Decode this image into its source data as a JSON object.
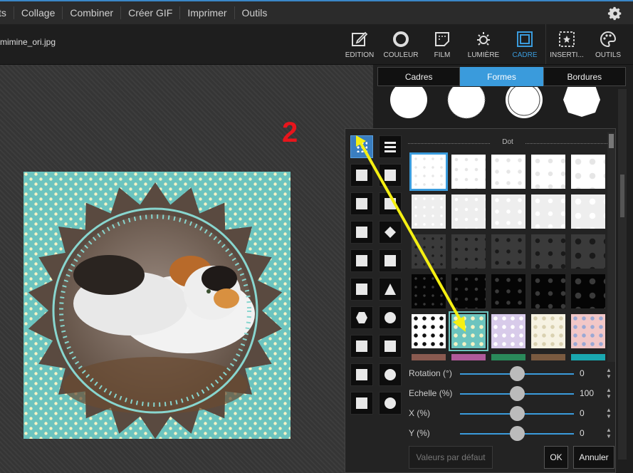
{
  "menu": {
    "items": [
      "ts",
      "Collage",
      "Combiner",
      "Créer GIF",
      "Imprimer",
      "Outils"
    ]
  },
  "file": {
    "name": "mimine_ori.jpg"
  },
  "toolbar": {
    "tools": [
      {
        "label": "EDITION",
        "icon": "edit-icon"
      },
      {
        "label": "COULEUR",
        "icon": "color-icon"
      },
      {
        "label": "FILM",
        "icon": "film-icon"
      },
      {
        "label": "LUMIÈRE",
        "icon": "light-icon"
      },
      {
        "label": "CADRE",
        "icon": "frame-icon",
        "active": true
      },
      {
        "label": "INSERTI...",
        "icon": "insert-icon"
      },
      {
        "label": "OUTILS",
        "icon": "tools-palette-icon"
      }
    ]
  },
  "tabs": {
    "cadres": "Cadres",
    "formes": "Formes",
    "bordures": "Bordures",
    "active": "Formes"
  },
  "pattern_group": {
    "label": "Dot"
  },
  "annotation": {
    "number": "2"
  },
  "sliders": [
    {
      "label": "Rotation (°)",
      "value": "0",
      "fraction": 0.5
    },
    {
      "label": "Echelle (%)",
      "value": "100",
      "fraction": 0.5
    },
    {
      "label": "X (%)",
      "value": "0",
      "fraction": 0.5
    },
    {
      "label": "Y (%)",
      "value": "0",
      "fraction": 0.5
    }
  ],
  "buttons": {
    "defaults": "Valeurs par défaut",
    "ok": "OK",
    "cancel": "Annuler"
  },
  "colors": {
    "accent": "#3a9bdc",
    "photo_bg": "#6cc4bf",
    "arrow": "#f5f012",
    "annotation": "#e8151c"
  }
}
